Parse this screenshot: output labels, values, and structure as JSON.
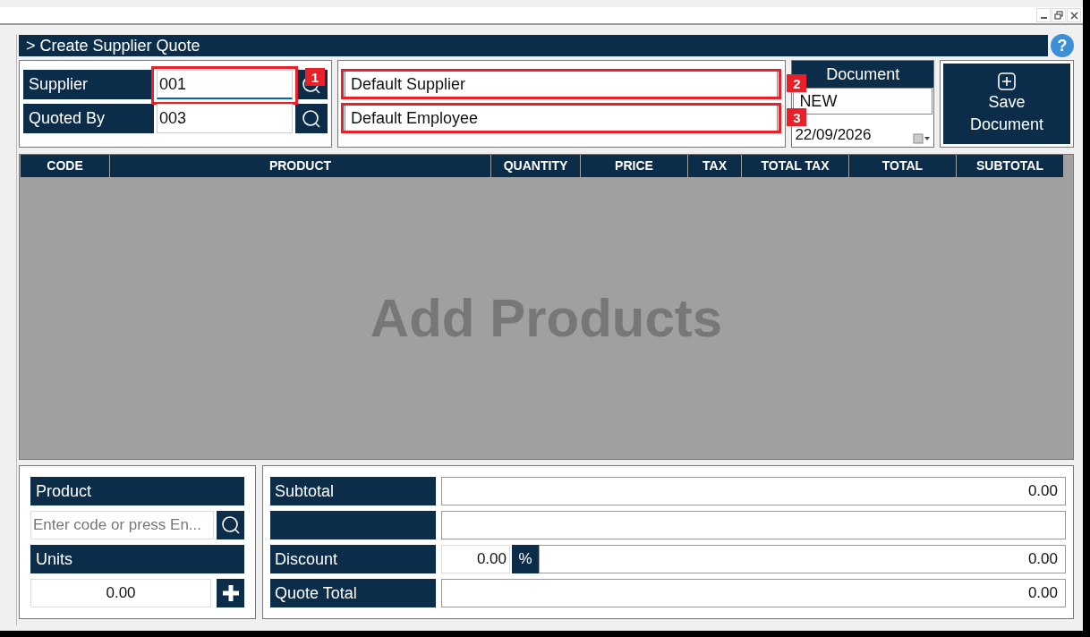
{
  "header": {
    "title": "> Create Supplier Quote",
    "help": "?"
  },
  "supplier": {
    "label": "Supplier",
    "value": "001",
    "focused": true,
    "name": "Default Supplier",
    "code_callout": "1",
    "name_callout": "2"
  },
  "quoted_by": {
    "label": "Quoted By",
    "value": "003",
    "focused": false,
    "name": "Default Employee",
    "name_callout": "3"
  },
  "document": {
    "title": "Document",
    "number": "NEW",
    "date": "22/09/2026"
  },
  "save_button": {
    "label": "Save Document"
  },
  "table": {
    "columns": [
      "CODE",
      "PRODUCT",
      "QUANTITY",
      "PRICE",
      "TAX",
      "TOTAL TAX",
      "TOTAL",
      "SUBTOTAL"
    ],
    "empty_text": "Add Products"
  },
  "product_entry": {
    "product_label": "Product",
    "product_placeholder": "Enter code or press En...",
    "units_label": "Units",
    "units_value": "0.00"
  },
  "totals": [
    {
      "kind": "plain",
      "label": "Subtotal",
      "value": "0.00"
    },
    {
      "kind": "plain"
    },
    {
      "kind": "discount",
      "label": "Discount",
      "rate": "0.00",
      "unit": "%",
      "value": "0.00"
    },
    {
      "kind": "plain",
      "label": "Quote Total",
      "value": "0.00"
    }
  ]
}
